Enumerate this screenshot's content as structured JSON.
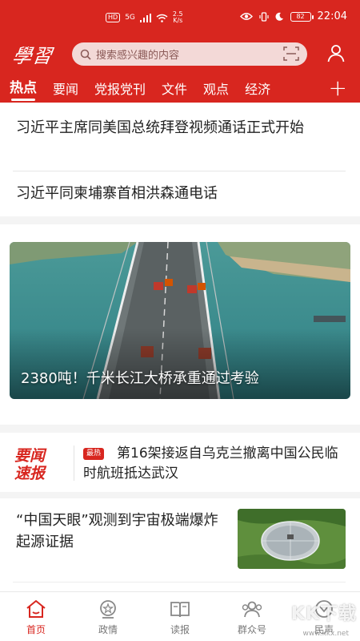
{
  "statusbar": {
    "hd": "HD",
    "signal": "5G",
    "speed_value": "2.5",
    "speed_unit": "K/s",
    "battery": "82",
    "time": "22:04"
  },
  "header": {
    "logo": "學習",
    "search_placeholder": "搜索感兴趣的内容",
    "tabs": [
      {
        "label": "热点"
      },
      {
        "label": "要闻"
      },
      {
        "label": "党报党刊"
      },
      {
        "label": "文件"
      },
      {
        "label": "观点"
      },
      {
        "label": "经济"
      }
    ],
    "plus": "+"
  },
  "headlines": [
    {
      "title": "习近平主席同美国总统拜登视频通话正式开始"
    },
    {
      "title": "习近平同柬埔寨首相洪森通电话"
    }
  ],
  "hero": {
    "caption": "2380吨！千米长江大桥承重通过考验"
  },
  "flash": {
    "logo_line1": "要闻",
    "logo_line2": "速报",
    "badge": "最热",
    "text": "第16架接返自乌克兰撤离中国公民临时航班抵达武汉"
  },
  "article": {
    "title": "“中国天眼”观测到宇宙极端爆炸起源证据"
  },
  "bottomnav": {
    "items": [
      {
        "label": "首页"
      },
      {
        "label": "政情"
      },
      {
        "label": "读报"
      },
      {
        "label": "群众号"
      },
      {
        "label": "民声"
      }
    ]
  },
  "watermark": {
    "text": "KK下载",
    "url": "www.kkx.net"
  },
  "colors": {
    "brand_red": "#d8261f"
  }
}
